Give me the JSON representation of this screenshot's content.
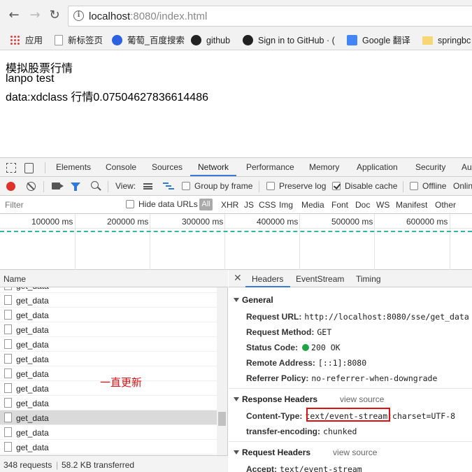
{
  "browser": {
    "url_host": "localhost",
    "url_rest": ":8080/index.html",
    "bookmarks": [
      "应用",
      "新标签页",
      "葡萄_百度搜索",
      "github",
      "Sign in to GitHub · (",
      "Google 翻译",
      "springbc"
    ]
  },
  "page": {
    "line1": "模拟股票行情",
    "line2": "lanpo test",
    "line3": "data:xdclass 行情0.07504627836614486"
  },
  "devtools": {
    "tabs": [
      "Elements",
      "Console",
      "Sources",
      "Network",
      "Performance",
      "Memory",
      "Application",
      "Security",
      "Au"
    ],
    "active_tab": "Network",
    "toolbar": {
      "view_label": "View:",
      "group_by_frame": "Group by frame",
      "preserve_log": "Preserve log",
      "disable_cache": "Disable cache",
      "offline": "Offline",
      "online": "Onlin"
    },
    "filter": {
      "placeholder": "Filter",
      "hide_data_urls": "Hide data URLs",
      "all": "All",
      "types": [
        "XHR",
        "JS",
        "CSS",
        "Img",
        "Media",
        "Font",
        "Doc",
        "WS",
        "Manifest",
        "Other"
      ]
    },
    "overview_ticks": [
      "100000 ms",
      "200000 ms",
      "300000 ms",
      "400000 ms",
      "500000 ms",
      "600000 ms"
    ],
    "requests": {
      "column": "Name",
      "partial_top": "get_data",
      "items": [
        "get_data",
        "get_data",
        "get_data",
        "get_data",
        "get_data",
        "get_data",
        "get_data",
        "get_data",
        "get_data",
        "get_data",
        "get_data"
      ],
      "selected_index": 8,
      "note": "一直更新",
      "status_count": "348 requests",
      "status_size": "58.2 KB transferred"
    },
    "details": {
      "tabs": [
        "Headers",
        "EventStream",
        "Timing"
      ],
      "general_title": "General",
      "general": [
        {
          "k": "Request URL:",
          "v": "http://localhost:8080/sse/get_data"
        },
        {
          "k": "Request Method:",
          "v": "GET"
        },
        {
          "k": "Status Code:",
          "v": "200 OK"
        },
        {
          "k": "Remote Address:",
          "v": "[::1]:8080"
        },
        {
          "k": "Referrer Policy:",
          "v": "no-referrer-when-downgrade"
        }
      ],
      "response_title": "Response Headers",
      "response": [
        {
          "k": "Content-Type:",
          "v": "text/event-stream;charset=UTF-8"
        },
        {
          "k": "transfer-encoding:",
          "v": "chunked"
        }
      ],
      "request_title": "Request Headers",
      "view_source": "view source",
      "request": [
        {
          "k": "Accept:",
          "v": "text/event-stream"
        }
      ]
    }
  },
  "colors": {
    "accent": "#3879d9",
    "record": "#e0302a",
    "status_ok": "#1ea446",
    "annotation": "#dd1111"
  }
}
